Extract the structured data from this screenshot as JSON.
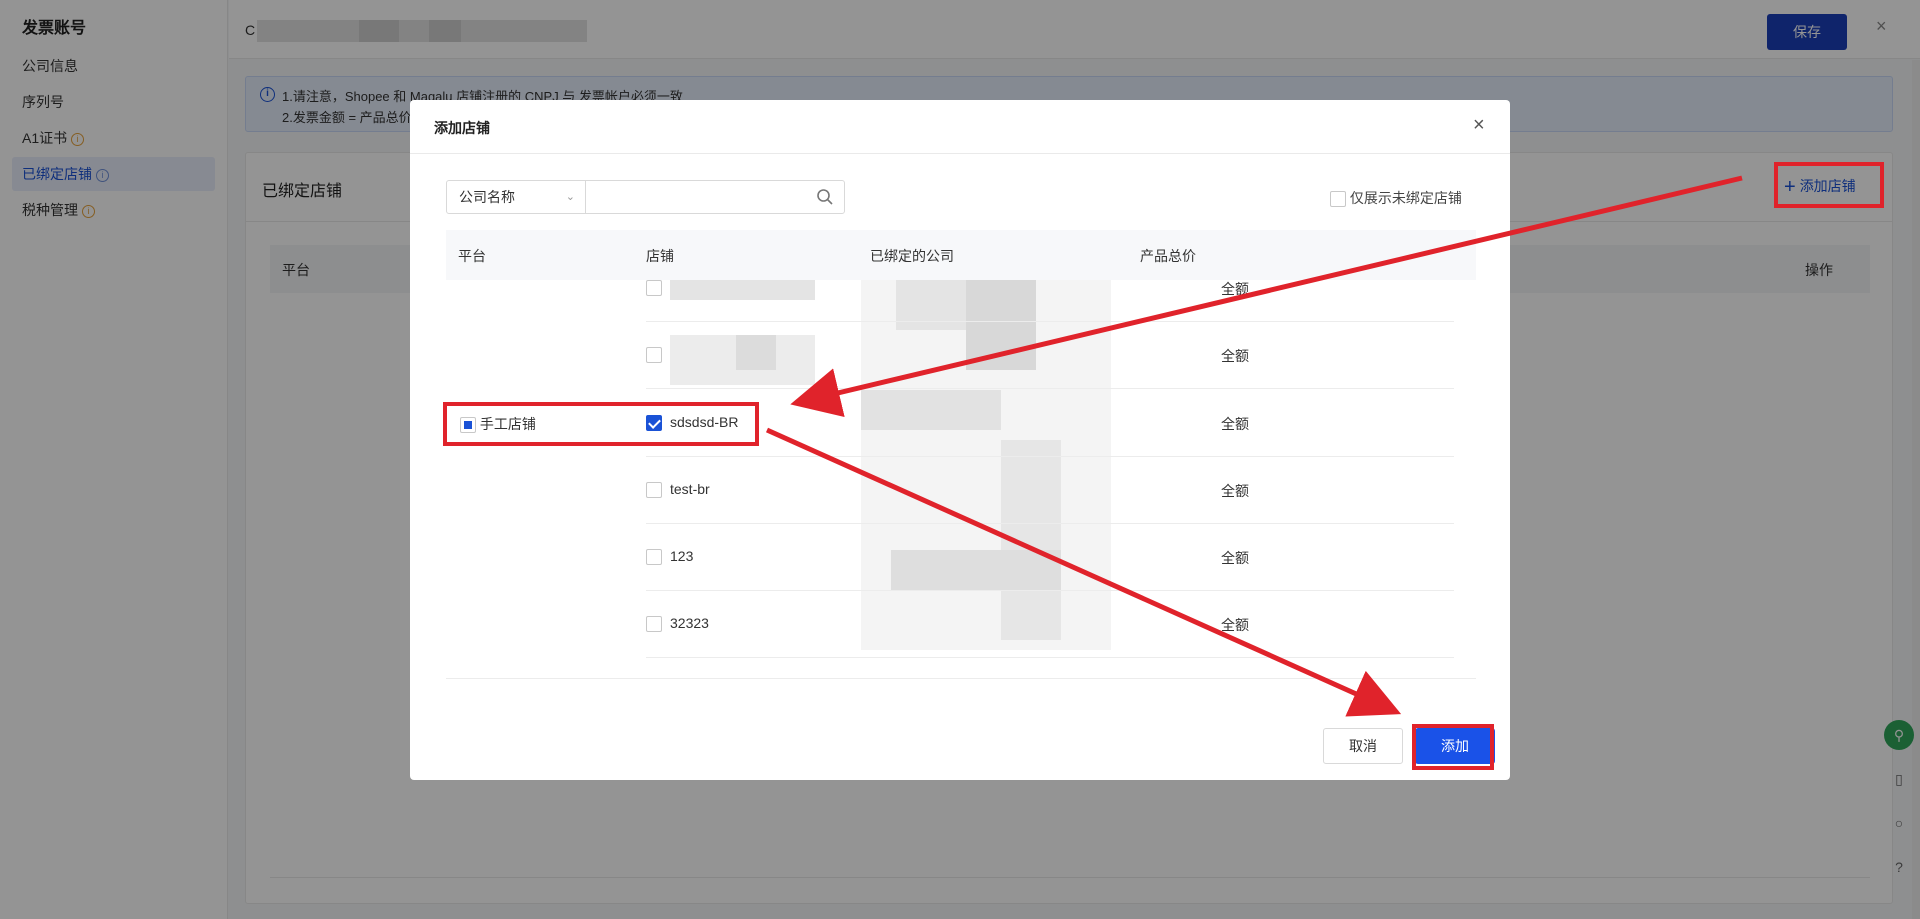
{
  "sidebar": {
    "title": "发票账号",
    "items": [
      {
        "label": "公司信息",
        "info": false
      },
      {
        "label": "序列号",
        "info": false
      },
      {
        "label": "A1证书",
        "info": true
      },
      {
        "label": "已绑定店铺",
        "info": true
      },
      {
        "label": "税种管理",
        "info": true
      }
    ]
  },
  "topbar": {
    "name_prefix": "C",
    "save_label": "保存",
    "close_label": "×"
  },
  "notice": {
    "line1": "1.请注意，Shopee 和 Magalu 店铺注册的 CNPJ 与 发票帐户必须一致",
    "line2": "2.发票金额 = 产品总价"
  },
  "card": {
    "title": "已绑定店铺",
    "add_store_label": "添加店铺",
    "columns": {
      "platform": "平台",
      "action": "操作"
    }
  },
  "modal": {
    "title": "添加店铺",
    "filter_select": "公司名称",
    "search_placeholder": "",
    "only_unbound_label": "仅展示未绑定店铺",
    "columns": {
      "platform": "平台",
      "store": "店铺",
      "bound_company": "已绑定的公司",
      "total_price": "产品总价"
    },
    "group_platform": "手工店铺",
    "rows": [
      {
        "store": "",
        "checked": false,
        "price": "全额"
      },
      {
        "store": "",
        "checked": false,
        "price": "全额"
      },
      {
        "store": "sdsdsd-BR",
        "checked": true,
        "price": "全额"
      },
      {
        "store": "test-br",
        "checked": false,
        "price": "全额"
      },
      {
        "store": "123",
        "checked": false,
        "price": "全额"
      },
      {
        "store": "32323",
        "checked": false,
        "price": "全额"
      }
    ],
    "cancel_label": "取消",
    "add_label": "添加"
  },
  "colors": {
    "accent": "#1a52d6",
    "primary_button": "#1a3fb8",
    "annotation": "#e0232b"
  }
}
